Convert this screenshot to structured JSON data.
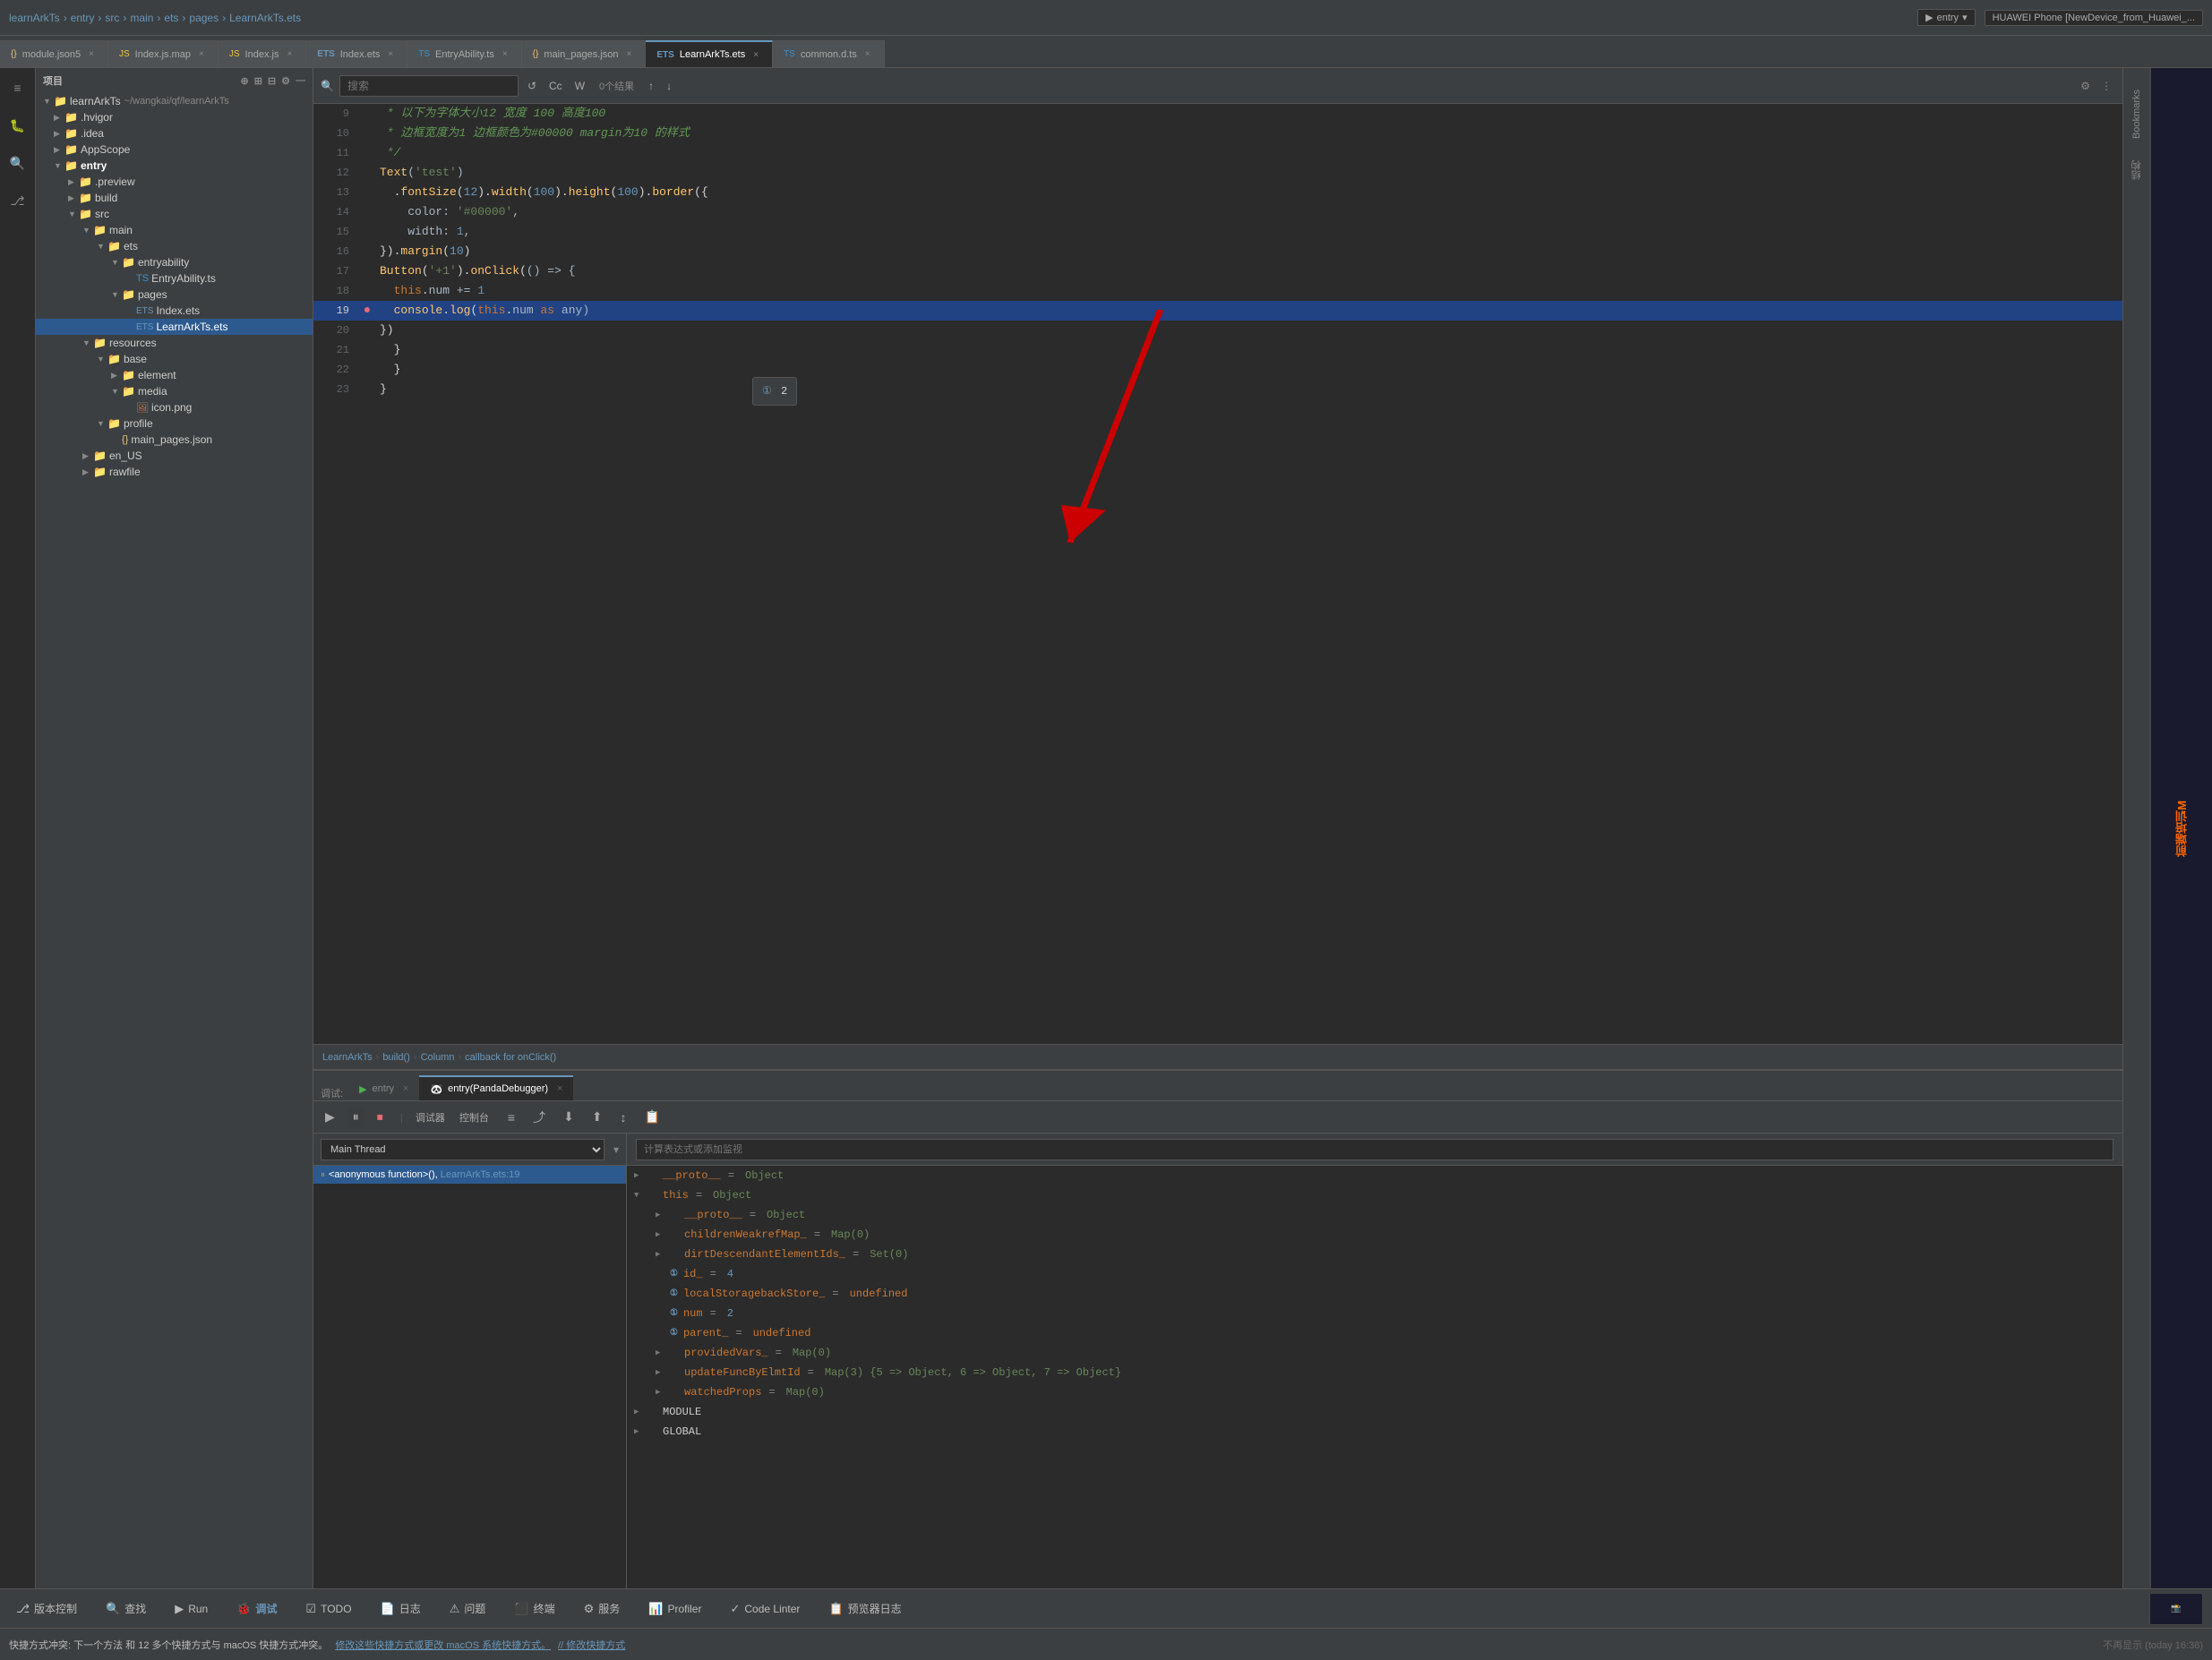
{
  "app": {
    "title": "learnArkTs",
    "breadcrumb": [
      "learnArkTs",
      "entry",
      "src",
      "main",
      "ets",
      "pages",
      "LearnArkTs.ets"
    ]
  },
  "tabs": [
    {
      "id": "module_json5",
      "label": "module.json5",
      "icon": "{}",
      "active": false
    },
    {
      "id": "index_js_map",
      "label": "Index.js.map",
      "icon": "JS",
      "active": false
    },
    {
      "id": "index_js",
      "label": "Index.js",
      "icon": "JS",
      "active": false
    },
    {
      "id": "index_ets",
      "label": "Index.ets",
      "icon": "ETS",
      "active": false
    },
    {
      "id": "entry_ability_ts",
      "label": "EntryAbility.ts",
      "icon": "TS",
      "active": false
    },
    {
      "id": "main_pages_json",
      "label": "main_pages.json",
      "icon": "{}",
      "active": false
    },
    {
      "id": "learn_ark_ts_ets",
      "label": "LearnArkTs.ets",
      "icon": "ETS",
      "active": true
    },
    {
      "id": "common_d_ts",
      "label": "common.d.ts",
      "icon": "TS",
      "active": false
    }
  ],
  "search": {
    "placeholder": "搜索",
    "result_text": "0个结果",
    "cc_btn": "Cc",
    "w_btn": "W",
    "case_icon": "Aa",
    "filter_icon": "⚙"
  },
  "code_lines": [
    {
      "num": 9,
      "content": " * 以下为字体大小12 宽度 100 高度100",
      "type": "comment"
    },
    {
      "num": 10,
      "content": " * 边框宽度为1 边框颜色为#00000 margin为10 的样式",
      "type": "comment"
    },
    {
      "num": 11,
      "content": " */",
      "type": "comment"
    },
    {
      "num": 12,
      "content": "Text('test')",
      "type": "code"
    },
    {
      "num": 13,
      "content": "  .fontSize(12).width(100).height(100).border({",
      "type": "code"
    },
    {
      "num": 14,
      "content": "    color: '#00000',",
      "type": "code"
    },
    {
      "num": 15,
      "content": "    width: 1,",
      "type": "code"
    },
    {
      "num": 16,
      "content": "}).margin(10)",
      "type": "code"
    },
    {
      "num": 17,
      "content": "Button('+1').onClick(() => {",
      "type": "code"
    },
    {
      "num": 18,
      "content": "  this.num += 1",
      "type": "code"
    },
    {
      "num": 19,
      "content": "  console.log(this.num as any)",
      "type": "code",
      "highlighted": true,
      "breakpoint": true
    },
    {
      "num": 20,
      "content": "})",
      "type": "code"
    },
    {
      "num": 21,
      "content": "  }",
      "type": "code"
    },
    {
      "num": 22,
      "content": "  }",
      "type": "code"
    },
    {
      "num": 23,
      "content": "}",
      "type": "code"
    }
  ],
  "tooltip": {
    "icon": "①",
    "value": "2"
  },
  "status_breadcrumb": {
    "items": [
      "LearnArkTs",
      "build()",
      "Column",
      "callback for onClick()"
    ]
  },
  "debug": {
    "tabs": [
      {
        "label": "调试:",
        "active": false
      },
      {
        "label": "entry",
        "icon": "▶",
        "close": true,
        "active": false
      },
      {
        "label": "entry(PandaDebugger)",
        "icon": "🐼",
        "close": true,
        "active": true
      }
    ],
    "toolbar_buttons": [
      "▶",
      "⏸",
      "⏹",
      "↩",
      "↪",
      "⬆",
      "⬇",
      "↕",
      "📋"
    ],
    "toolbar_labels": [
      "调试器",
      "控制台",
      "≡",
      "⬆",
      "⬇",
      "⬆",
      "↕",
      "📋"
    ],
    "thread_label": "Main Thread",
    "stack_items": [
      {
        "label": "<anonymous function>(), LearnArkTs.ets:19",
        "active": true,
        "icon": "□"
      }
    ],
    "watch_placeholder": "计算表达式或添加监视",
    "variables": [
      {
        "level": 0,
        "expanded": false,
        "arrow": "▶",
        "icon": null,
        "name": "__proto__",
        "eq": "=",
        "value": "Object",
        "type": ""
      },
      {
        "level": 0,
        "expanded": true,
        "arrow": "▼",
        "icon": null,
        "name": "this",
        "eq": "=",
        "value": "Object",
        "type": ""
      },
      {
        "level": 1,
        "expanded": false,
        "arrow": "▶",
        "icon": null,
        "name": "__proto__",
        "eq": "=",
        "value": "Object",
        "type": ""
      },
      {
        "level": 1,
        "expanded": false,
        "arrow": "▶",
        "icon": null,
        "name": "childrenWeakrefMap_",
        "eq": "=",
        "value": "Map(0)",
        "type": ""
      },
      {
        "level": 1,
        "expanded": false,
        "arrow": "▶",
        "icon": null,
        "name": "dirtDescendantElementIds_",
        "eq": "=",
        "value": "Set(0)",
        "type": ""
      },
      {
        "level": 1,
        "expanded": false,
        "arrow": null,
        "icon": "①",
        "name": "id_",
        "eq": "=",
        "value": "4",
        "type": ""
      },
      {
        "level": 1,
        "expanded": false,
        "arrow": null,
        "icon": "①",
        "name": "localStoragebackStore_",
        "eq": "=",
        "value": "undefined",
        "type": ""
      },
      {
        "level": 1,
        "expanded": false,
        "arrow": null,
        "icon": "①",
        "name": "num",
        "eq": "=",
        "value": "2",
        "type": ""
      },
      {
        "level": 1,
        "expanded": false,
        "arrow": null,
        "icon": "①",
        "name": "parent_",
        "eq": "=",
        "value": "undefined",
        "type": ""
      },
      {
        "level": 1,
        "expanded": false,
        "arrow": "▶",
        "icon": null,
        "name": "providedVars_",
        "eq": "=",
        "value": "Map(0)",
        "type": ""
      },
      {
        "level": 1,
        "expanded": false,
        "arrow": "▶",
        "icon": null,
        "name": "updateFuncByElmtId",
        "eq": "=",
        "value": "= Map(3) {5 => Object, 6 => Object, 7 => Object}",
        "type": ""
      },
      {
        "level": 1,
        "expanded": false,
        "arrow": "▶",
        "icon": null,
        "name": "watchedProps",
        "eq": "=",
        "value": "Map(0)",
        "type": ""
      },
      {
        "level": 0,
        "expanded": false,
        "arrow": "▶",
        "icon": null,
        "name": "MODULE",
        "eq": "",
        "value": "",
        "type": ""
      },
      {
        "level": 0,
        "expanded": false,
        "arrow": "▶",
        "icon": null,
        "name": "GLOBAL",
        "eq": "",
        "value": "",
        "type": ""
      }
    ]
  },
  "bottom_status_bar": {
    "buttons": [
      {
        "label": "版本控制",
        "icon": "⎇"
      },
      {
        "label": "查找",
        "icon": "🔍"
      },
      {
        "label": "Run",
        "icon": "▶"
      },
      {
        "label": "调试",
        "icon": "🐞",
        "active": true
      },
      {
        "label": "TODO",
        "icon": "☑"
      },
      {
        "label": "日志",
        "icon": "📄"
      },
      {
        "label": "问题",
        "icon": "⚠"
      },
      {
        "label": "终端",
        "icon": "⬛"
      },
      {
        "label": "服务",
        "icon": "⚙"
      },
      {
        "label": "Profiler",
        "icon": "📊"
      },
      {
        "label": "Code Linter",
        "icon": "✓"
      },
      {
        "label": "预览器日志",
        "icon": "📋"
      }
    ]
  },
  "notification": {
    "text": "快捷方式冲突: 下一个方法 和 12 多个快捷方式与 macOS 快捷方式冲突。",
    "link1": "修改这些快捷方式或更改 macOS 系统快捷方式。",
    "link2": "// 修改快捷方式",
    "dismiss": "不再显示 (today 16:38)"
  },
  "sidebar": {
    "project_label": "项目",
    "root": {
      "name": "learnArkTs",
      "path": "~/wangkai/qf/learnArkTs"
    },
    "tree": [
      {
        "id": "hvigor",
        "label": ".hvigor",
        "type": "folder",
        "level": 1,
        "collapsed": true
      },
      {
        "id": "idea",
        "label": ".idea",
        "type": "folder",
        "level": 1,
        "collapsed": true
      },
      {
        "id": "appscope",
        "label": "AppScope",
        "type": "folder",
        "level": 1,
        "collapsed": true
      },
      {
        "id": "entry",
        "label": "entry",
        "type": "folder",
        "level": 1,
        "collapsed": false,
        "bold": true
      },
      {
        "id": "preview",
        "label": ".preview",
        "type": "folder",
        "level": 2,
        "collapsed": true
      },
      {
        "id": "build",
        "label": "build",
        "type": "folder",
        "level": 2,
        "collapsed": true
      },
      {
        "id": "src",
        "label": "src",
        "type": "folder",
        "level": 2,
        "collapsed": false
      },
      {
        "id": "main",
        "label": "main",
        "type": "folder",
        "level": 3,
        "collapsed": false
      },
      {
        "id": "ets",
        "label": "ets",
        "type": "folder",
        "level": 4,
        "collapsed": false
      },
      {
        "id": "entryability",
        "label": "entryability",
        "type": "folder",
        "level": 5,
        "collapsed": false
      },
      {
        "id": "entryability_ts",
        "label": "EntryAbility.ts",
        "type": "ts-file",
        "level": 6
      },
      {
        "id": "pages",
        "label": "pages",
        "type": "folder",
        "level": 5,
        "collapsed": false
      },
      {
        "id": "index_ets_file",
        "label": "Index.ets",
        "type": "ets-file",
        "level": 6
      },
      {
        "id": "learnarkts_ets_file",
        "label": "LearnArkTs.ets",
        "type": "ets-file",
        "level": 6,
        "selected": true
      },
      {
        "id": "resources",
        "label": "resources",
        "type": "folder",
        "level": 3,
        "collapsed": false
      },
      {
        "id": "base",
        "label": "base",
        "type": "folder",
        "level": 4,
        "collapsed": false
      },
      {
        "id": "element",
        "label": "element",
        "type": "folder",
        "level": 5,
        "collapsed": true
      },
      {
        "id": "media",
        "label": "media",
        "type": "folder",
        "level": 5,
        "collapsed": false
      },
      {
        "id": "icon_png",
        "label": "icon.png",
        "type": "image-file",
        "level": 6
      },
      {
        "id": "profile",
        "label": "profile",
        "type": "folder",
        "level": 4,
        "collapsed": false
      },
      {
        "id": "main_pages_json_file",
        "label": "main_pages.json",
        "type": "json-file",
        "level": 5
      },
      {
        "id": "en_us",
        "label": "en_US",
        "type": "folder",
        "level": 3,
        "collapsed": true
      },
      {
        "id": "rawfile",
        "label": "rawfile",
        "type": "folder",
        "level": 3,
        "collapsed": true
      }
    ]
  },
  "right_panel": {
    "label": "前端培训M"
  }
}
